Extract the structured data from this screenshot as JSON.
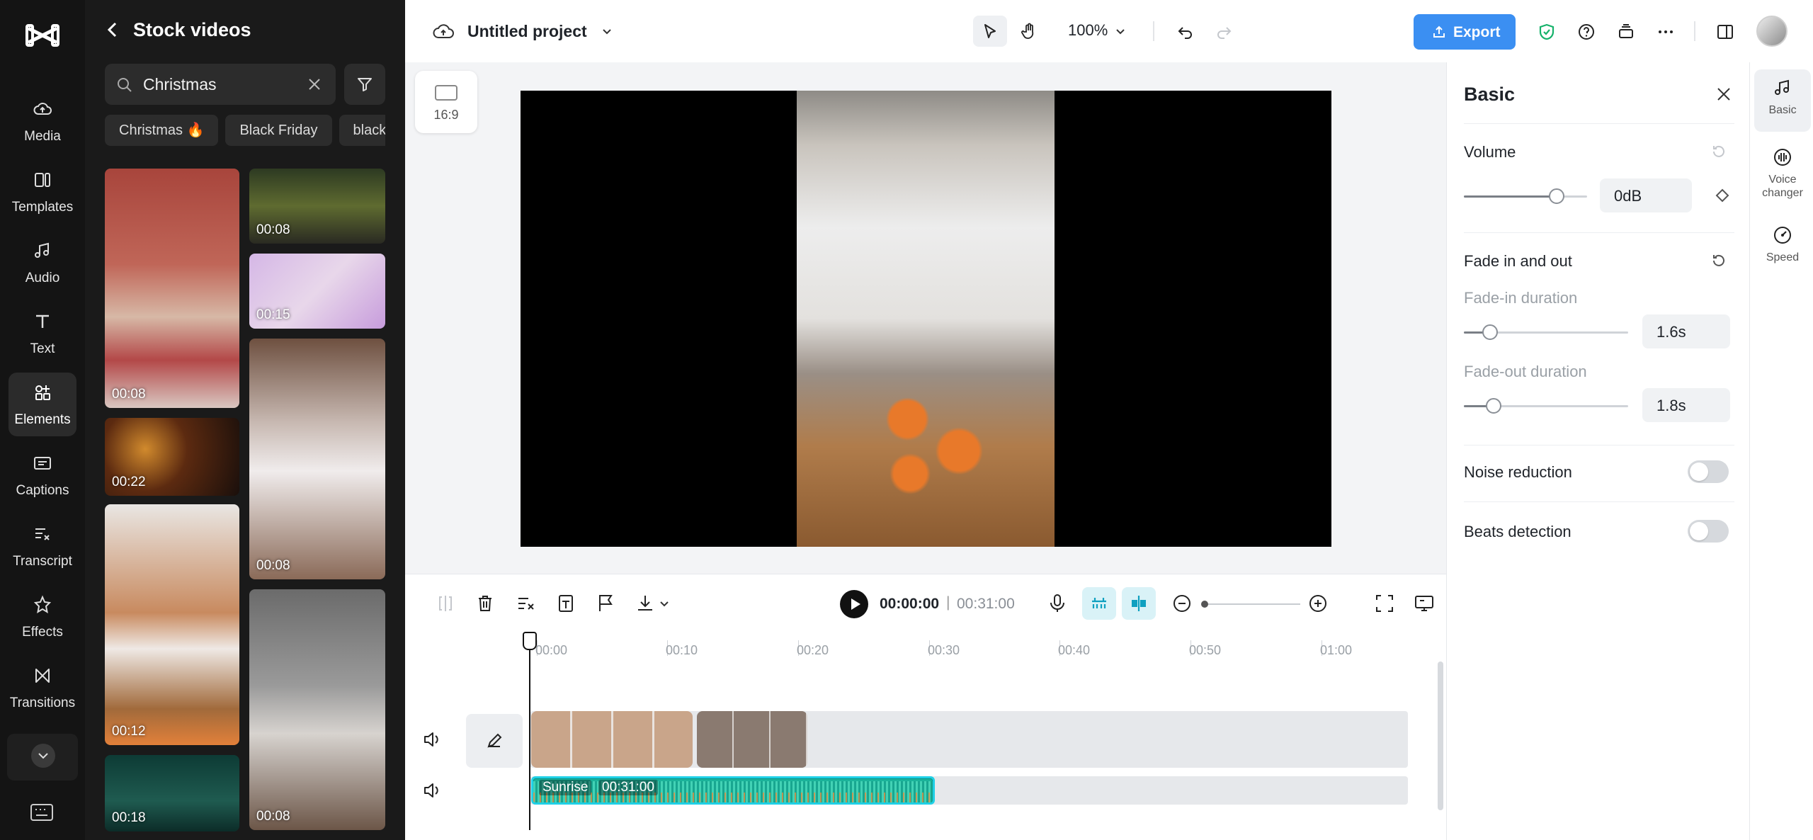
{
  "nav": {
    "items": [
      {
        "label": "Media",
        "icon": "media-cloud-icon"
      },
      {
        "label": "Templates",
        "icon": "templates-icon"
      },
      {
        "label": "Audio",
        "icon": "music-note-icon"
      },
      {
        "label": "Text",
        "icon": "text-icon"
      },
      {
        "label": "Elements",
        "icon": "elements-icon",
        "active": true
      },
      {
        "label": "Captions",
        "icon": "captions-icon"
      },
      {
        "label": "Transcript",
        "icon": "transcript-icon"
      },
      {
        "label": "Effects",
        "icon": "effects-star-icon"
      },
      {
        "label": "Transitions",
        "icon": "transitions-icon"
      }
    ]
  },
  "panel": {
    "title": "Stock videos",
    "search_value": "Christmas",
    "chips": [
      "Christmas 🔥",
      "Black Friday",
      "black"
    ],
    "thumbnails": [
      {
        "duration": "00:08"
      },
      {
        "duration": "00:08"
      },
      {
        "duration": "00:15"
      },
      {
        "duration": "00:08"
      },
      {
        "duration": "00:22"
      },
      {
        "duration": "00:12"
      },
      {
        "duration": "00:08"
      },
      {
        "duration": "00:18"
      }
    ]
  },
  "topbar": {
    "project_title": "Untitled project",
    "zoom": "100%",
    "export_label": "Export"
  },
  "canvas": {
    "aspect_ratio": "16:9"
  },
  "player": {
    "current_time": "00:00:00",
    "separator": "|",
    "total_time": "00:31:00"
  },
  "timeline": {
    "ruler": [
      "00:00",
      "00:10",
      "00:20",
      "00:30",
      "00:40",
      "00:50",
      "01:00"
    ],
    "audio_clip": {
      "name": "Sunrise",
      "duration": "00:31:00"
    }
  },
  "props": {
    "title": "Basic",
    "volume": {
      "label": "Volume",
      "value": "0dB",
      "level": 0.75
    },
    "fade": {
      "label": "Fade in and out",
      "fade_in_label": "Fade-in duration",
      "fade_in_value": "1.6s",
      "fade_in_level": 0.16,
      "fade_out_label": "Fade-out duration",
      "fade_out_value": "1.8s",
      "fade_out_level": 0.18
    },
    "noise_reduction": {
      "label": "Noise reduction",
      "on": false
    },
    "beats_detection": {
      "label": "Beats detection",
      "on": false
    }
  },
  "right_tabs": [
    {
      "label": "Basic",
      "icon": "music-note-icon",
      "active": true
    },
    {
      "label": "Voice changer",
      "icon": "voice-changer-icon"
    },
    {
      "label": "Speed",
      "icon": "speed-gauge-icon"
    }
  ],
  "colors": {
    "accent": "#3b8ff2",
    "audio_clip": "#1bb39a",
    "shield": "#16b26b"
  }
}
